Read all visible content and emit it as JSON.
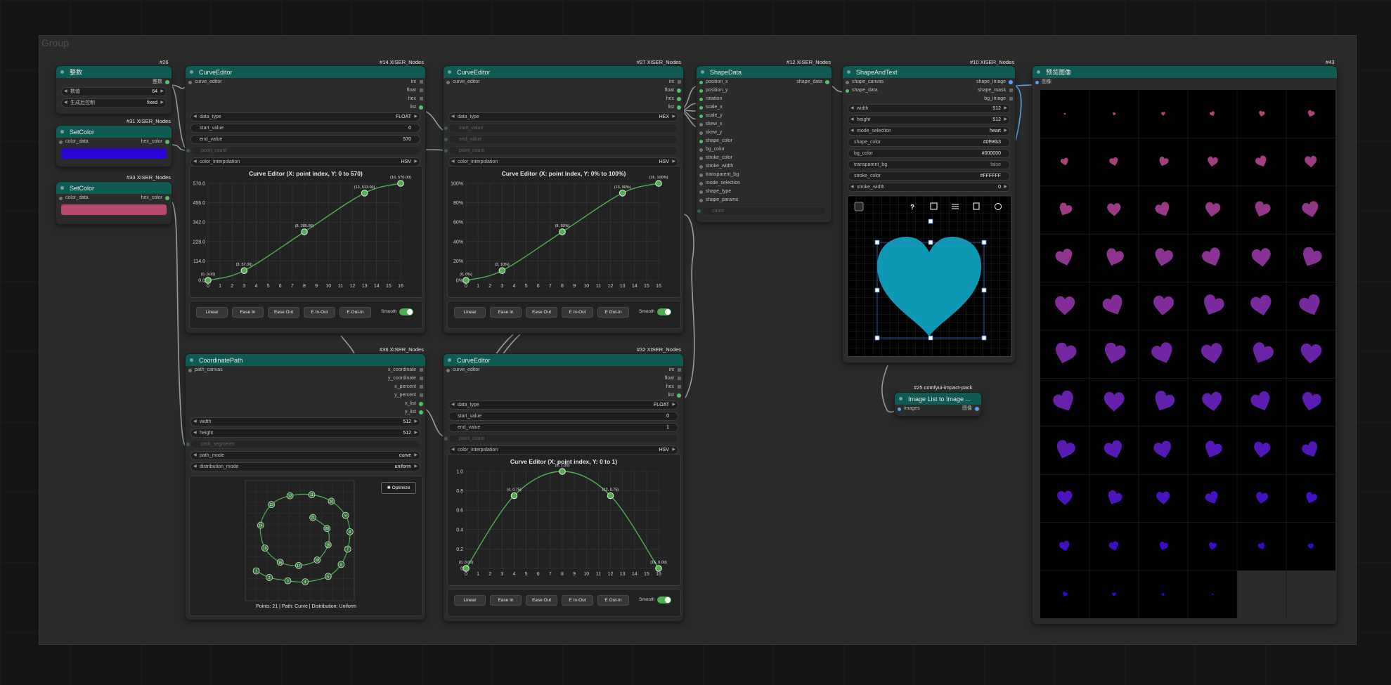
{
  "group": {
    "title": "Group"
  },
  "nodes": {
    "int_node": {
      "id": "#26",
      "title": "整数",
      "output": "整数",
      "value_label": "数值",
      "value": "64",
      "control_label": "生成后控制",
      "control_value": "fixed"
    },
    "setcolor1": {
      "id": "#31 XISER_Nodes",
      "title": "SetColor",
      "input": "color_data",
      "output": "hex_color",
      "color": "#2a05d4"
    },
    "setcolor2": {
      "id": "#33 XISER_Nodes",
      "title": "SetColor",
      "input": "color_data",
      "output": "hex_color",
      "color": "#b84870"
    },
    "curve14": {
      "id": "#14 XISER_Nodes",
      "title": "CurveEditor",
      "input": "curve_editor",
      "outputs": [
        "int",
        "float",
        "hex",
        "list"
      ],
      "data_type_label": "data_type",
      "data_type": "FLOAT",
      "start_label": "start_value",
      "start_value": "0",
      "end_label": "end_value",
      "end_value": "570",
      "point_count": "point_count",
      "interp_label": "color_interpolation",
      "interp": "HSV"
    },
    "curve27": {
      "id": "#27 XISER_Nodes",
      "title": "CurveEditor",
      "input": "curve_editor",
      "outputs": [
        "int",
        "float",
        "hex",
        "list"
      ],
      "data_type_label": "data_type",
      "data_type": "HEX",
      "start_label": "start_value",
      "end_label": "end_value",
      "point_count": "point_count",
      "interp_label": "color_interpolation",
      "interp": "HSV"
    },
    "curve32": {
      "id": "#32 XISER_Nodes",
      "title": "CurveEditor",
      "input": "curve_editor",
      "outputs": [
        "int",
        "float",
        "hex",
        "list"
      ],
      "data_type_label": "data_type",
      "data_type": "FLOAT",
      "start_label": "start_value",
      "start_value": "0",
      "end_label": "end_value",
      "end_value": "1",
      "point_count": "point_count",
      "interp_label": "color_interpolation",
      "interp": "HSV"
    },
    "shapedata": {
      "id": "#12 XISER_Nodes",
      "title": "ShapeData",
      "output": "shape_data",
      "inputs": [
        "position_x",
        "position_y",
        "rotation",
        "scale_x",
        "scale_y",
        "skew_x",
        "skew_y",
        "shape_color",
        "bg_color",
        "stroke_color",
        "stroke_width",
        "transparent_bg",
        "mode_selection",
        "shape_type",
        "shape_params"
      ],
      "count": "count"
    },
    "shapeandtext": {
      "id": "#10 XISER_Nodes",
      "title": "ShapeAndText",
      "inputs": [
        "shape_canvas",
        "shape_data"
      ],
      "outputs": [
        "shape_image",
        "shape_mask",
        "bg_image"
      ],
      "widgets": [
        {
          "label": "width",
          "value": "512"
        },
        {
          "label": "height",
          "value": "512"
        },
        {
          "label": "mode_selection",
          "value": "heart"
        },
        {
          "label": "shape_color",
          "value": "#0f98b3"
        },
        {
          "label": "bg_color",
          "value": "#000000"
        },
        {
          "label": "transparent_bg",
          "value": "false"
        },
        {
          "label": "stroke_color",
          "value": "#FFFFFF"
        },
        {
          "label": "stroke_width",
          "value": "0"
        }
      ],
      "toolbar": [
        "?",
        "grid-icon",
        "align-icon",
        "flip-icon",
        "reset-icon"
      ],
      "heart_color": "#0f98b3"
    },
    "coordpath": {
      "id": "#36 XISER_Nodes",
      "title": "CoordinatePath",
      "input": "path_canvas",
      "outputs": [
        "x_coordinate",
        "y_coordinate",
        "x_percent",
        "y_percent",
        "x_list",
        "y_list"
      ],
      "widgets": [
        {
          "label": "width",
          "value": "512"
        },
        {
          "label": "height",
          "value": "512"
        },
        {
          "label": "path_segments",
          "value": ""
        },
        {
          "label": "path_mode",
          "value": "curve"
        },
        {
          "label": "distribution_mode",
          "value": "uniform"
        }
      ],
      "optimize": "Optimize",
      "status": "Points: 21 | Path: Curve | Distribution: Uniform"
    },
    "imagelist": {
      "id": "#25 comfyui-impact-pack",
      "title": "Image List to Image ...",
      "input": "images",
      "output": "图像"
    },
    "preview": {
      "id": "#43",
      "title": "预览图像",
      "input": "图像"
    }
  },
  "buttons": [
    "Linear",
    "Ease In",
    "Ease Out",
    "E In-Out",
    "E Out-In"
  ],
  "smooth_label": "Smooth",
  "charts": {
    "c14": {
      "type": "line",
      "title": "Curve Editor (X: point index, Y: 0 to 570)",
      "x_ticks": [
        0,
        1,
        2,
        3,
        4,
        5,
        6,
        7,
        8,
        9,
        10,
        11,
        12,
        13,
        14,
        15,
        16
      ],
      "y_ticks": [
        "0.0",
        "114.0",
        "228.0",
        "342.0",
        "456.0",
        "570.0"
      ],
      "ylim": [
        0,
        570
      ],
      "points": [
        {
          "x": 0,
          "y": 0,
          "label": "(0, 0.00)"
        },
        {
          "x": 3,
          "y": 57,
          "label": "(3, 57.00)"
        },
        {
          "x": 8,
          "y": 285,
          "label": "(8, 285.00)"
        },
        {
          "x": 13,
          "y": 513,
          "label": "(13, 513.00)"
        },
        {
          "x": 16,
          "y": 570,
          "label": "(16, 570.00)"
        }
      ]
    },
    "c27": {
      "type": "line",
      "title": "Curve Editor (X: point index, Y: 0% to 100%)",
      "x_ticks": [
        0,
        1,
        2,
        3,
        4,
        5,
        6,
        7,
        8,
        9,
        10,
        11,
        12,
        13,
        14,
        15,
        16
      ],
      "y_ticks": [
        "0%",
        "20%",
        "40%",
        "60%",
        "80%",
        "100%"
      ],
      "ylim": [
        0,
        100
      ],
      "points": [
        {
          "x": 0,
          "y": 0,
          "label": "(0, 0%)"
        },
        {
          "x": 3,
          "y": 10,
          "label": "(3, 10%)"
        },
        {
          "x": 8,
          "y": 50,
          "label": "(8, 50%)"
        },
        {
          "x": 13,
          "y": 90,
          "label": "(13, 90%)"
        },
        {
          "x": 16,
          "y": 100,
          "label": "(16, 100%)"
        }
      ]
    },
    "c32": {
      "type": "line",
      "title": "Curve Editor (X: point index, Y: 0 to 1)",
      "x_ticks": [
        0,
        1,
        2,
        3,
        4,
        5,
        6,
        7,
        8,
        9,
        10,
        11,
        12,
        13,
        14,
        15,
        16
      ],
      "y_ticks": [
        "0",
        "0.2",
        "0.4",
        "0.6",
        "0.8",
        "1.0"
      ],
      "ylim": [
        0,
        1
      ],
      "points": [
        {
          "x": 0,
          "y": 0,
          "label": "(0, 0.00)"
        },
        {
          "x": 4,
          "y": 0.75,
          "label": "(4, 0.75)"
        },
        {
          "x": 8,
          "y": 1,
          "label": "(8, 1.00)"
        },
        {
          "x": 12,
          "y": 0.75,
          "label": "(12, 0.75)"
        },
        {
          "x": 16,
          "y": 0,
          "label": "(16, 0.00)"
        }
      ]
    }
  },
  "chart_data": [
    {
      "type": "line",
      "title": "Curve Editor (X: point index, Y: 0 to 570)",
      "x": [
        0,
        3,
        8,
        13,
        16
      ],
      "values": [
        0,
        57,
        285,
        513,
        570
      ],
      "ylim": [
        0,
        570
      ]
    },
    {
      "type": "line",
      "title": "Curve Editor (X: point index, Y: 0% to 100%)",
      "x": [
        0,
        3,
        8,
        13,
        16
      ],
      "values": [
        0,
        10,
        50,
        90,
        100
      ],
      "ylim": [
        0,
        100
      ]
    },
    {
      "type": "line",
      "title": "Curve Editor (X: point index, Y: 0 to 1)",
      "x": [
        0,
        4,
        8,
        12,
        16
      ],
      "values": [
        0,
        0.75,
        1,
        0.75,
        0
      ],
      "ylim": [
        0,
        1
      ]
    }
  ],
  "spiral_numbers": [
    1,
    2,
    3,
    4,
    5,
    6,
    7,
    8,
    9,
    10,
    11,
    12,
    13,
    14,
    15,
    16,
    17,
    18,
    19,
    20,
    21
  ],
  "spiral_points": [
    [
      1,
      2.2
    ],
    [
      2.2,
      1.6
    ],
    [
      3.9,
      1.3
    ],
    [
      5.5,
      1.2
    ],
    [
      7.6,
      1.7
    ],
    [
      8.8,
      2.8
    ],
    [
      9.4,
      4.2
    ],
    [
      9.6,
      5.8
    ],
    [
      9.2,
      7.3
    ],
    [
      7.9,
      8.6
    ],
    [
      6.1,
      9.2
    ],
    [
      4.1,
      9.1
    ],
    [
      2.4,
      8.3
    ],
    [
      1.4,
      6.4
    ],
    [
      1.8,
      4.3
    ],
    [
      3.2,
      3
    ],
    [
      4.9,
      2.7
    ],
    [
      6.6,
      3.2
    ],
    [
      7.6,
      4.6
    ],
    [
      7.5,
      6.1
    ],
    [
      6.2,
      7.1
    ]
  ],
  "preview_grid": {
    "cols": 6,
    "rows": 11,
    "hearts": 64
  }
}
